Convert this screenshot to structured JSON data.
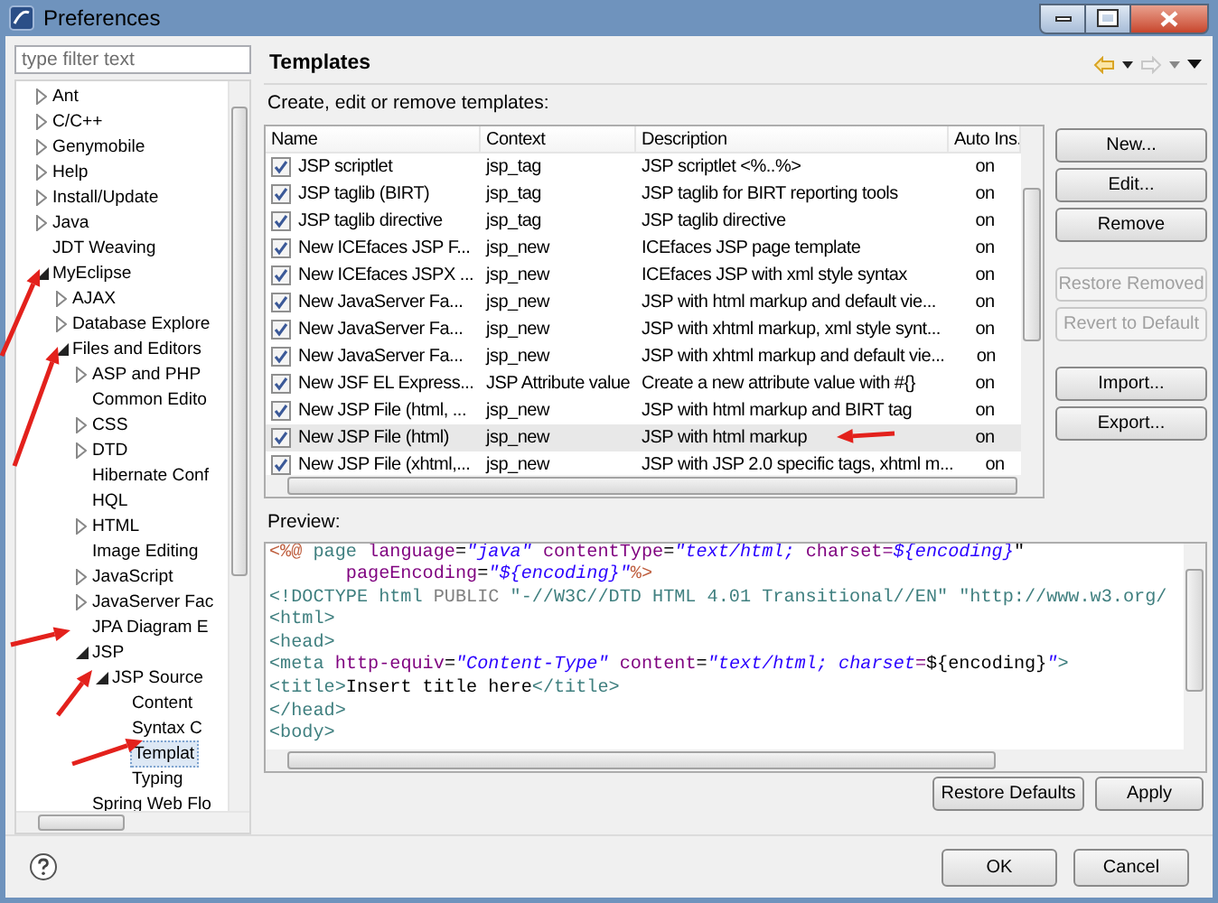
{
  "window": {
    "title": "Preferences"
  },
  "filter": {
    "placeholder": "type filter text"
  },
  "tree": [
    {
      "label": "Ant",
      "kind": "folder",
      "expanded": false,
      "selected": false
    },
    {
      "label": "C/C++",
      "kind": "folder",
      "expanded": false,
      "selected": false
    },
    {
      "label": "Genymobile",
      "kind": "folder",
      "expanded": false,
      "selected": false
    },
    {
      "label": "Help",
      "kind": "folder",
      "expanded": false,
      "selected": false
    },
    {
      "label": "Install/Update",
      "kind": "folder",
      "expanded": false,
      "selected": false
    },
    {
      "label": "Java",
      "kind": "folder",
      "expanded": false,
      "selected": false
    },
    {
      "label": "JDT Weaving",
      "kind": "leaf",
      "selected": false
    },
    {
      "label": "MyEclipse",
      "kind": "folder",
      "expanded": true,
      "selected": false,
      "children": [
        {
          "label": "AJAX",
          "kind": "folder",
          "expanded": false,
          "selected": false
        },
        {
          "label": "Database Explore",
          "kind": "folder",
          "expanded": false,
          "selected": false
        },
        {
          "label": "Files and Editors",
          "kind": "folder",
          "expanded": true,
          "selected": false,
          "children": [
            {
              "label": "ASP and PHP",
              "kind": "folder",
              "expanded": false,
              "selected": false
            },
            {
              "label": "Common Edito",
              "kind": "leaf",
              "selected": false
            },
            {
              "label": "CSS",
              "kind": "folder",
              "expanded": false,
              "selected": false
            },
            {
              "label": "DTD",
              "kind": "folder",
              "expanded": false,
              "selected": false
            },
            {
              "label": "Hibernate Conf",
              "kind": "leaf",
              "selected": false
            },
            {
              "label": "HQL",
              "kind": "leaf",
              "selected": false
            },
            {
              "label": "HTML",
              "kind": "folder",
              "expanded": false,
              "selected": false
            },
            {
              "label": "Image Editing",
              "kind": "leaf",
              "selected": false
            },
            {
              "label": "JavaScript",
              "kind": "folder",
              "expanded": false,
              "selected": false
            },
            {
              "label": "JavaServer Fac",
              "kind": "folder",
              "expanded": false,
              "selected": false
            },
            {
              "label": "JPA Diagram E",
              "kind": "leaf",
              "selected": false
            },
            {
              "label": "JSP",
              "kind": "folder",
              "expanded": true,
              "selected": false,
              "children": [
                {
                  "label": "JSP Source",
                  "kind": "folder",
                  "expanded": true,
                  "selected": false,
                  "children": [
                    {
                      "label": "Content",
                      "kind": "leaf",
                      "selected": false
                    },
                    {
                      "label": "Syntax C",
                      "kind": "leaf",
                      "selected": false
                    },
                    {
                      "label": "Templat",
                      "kind": "leaf",
                      "selected": true
                    },
                    {
                      "label": "Typing",
                      "kind": "leaf",
                      "selected": false
                    }
                  ]
                }
              ]
            },
            {
              "label": "Spring Web Flo",
              "kind": "leaf",
              "selected": false
            }
          ]
        }
      ]
    }
  ],
  "page": {
    "title": "Templates",
    "description": "Create, edit or remove templates:"
  },
  "table": {
    "columns": [
      "Name",
      "Context",
      "Description",
      "Auto Ins."
    ],
    "rows": [
      {
        "checked": true,
        "selected": false,
        "name": "JSP scriptlet",
        "context": "jsp_tag",
        "description": "JSP scriptlet <%..%>",
        "auto": "on"
      },
      {
        "checked": true,
        "selected": false,
        "name": "JSP taglib (BIRT)",
        "context": "jsp_tag",
        "description": "JSP taglib for BIRT reporting tools",
        "auto": "on"
      },
      {
        "checked": true,
        "selected": false,
        "name": "JSP taglib directive",
        "context": "jsp_tag",
        "description": "JSP taglib directive",
        "auto": "on"
      },
      {
        "checked": true,
        "selected": false,
        "name": "New ICEfaces JSP F...",
        "context": "jsp_new",
        "description": "ICEfaces JSP page template",
        "auto": "on"
      },
      {
        "checked": true,
        "selected": false,
        "name": "New ICEfaces JSPX ...",
        "context": "jsp_new",
        "description": "ICEfaces JSP with xml style syntax",
        "auto": "on"
      },
      {
        "checked": true,
        "selected": false,
        "name": "New JavaServer Fa...",
        "context": "jsp_new",
        "description": "JSP with html markup and default vie...",
        "auto": "on"
      },
      {
        "checked": true,
        "selected": false,
        "name": "New JavaServer Fa...",
        "context": "jsp_new",
        "description": "JSP with xhtml markup, xml style synt...",
        "auto": "on"
      },
      {
        "checked": true,
        "selected": false,
        "name": "New JavaServer Fa...",
        "context": "jsp_new",
        "description": "JSP with xhtml markup and default vie...",
        "auto": "on"
      },
      {
        "checked": true,
        "selected": false,
        "name": "New JSF EL Express...",
        "context": "JSP Attribute value",
        "description": "Create a new attribute value with #{}",
        "auto": "on"
      },
      {
        "checked": true,
        "selected": false,
        "name": "New JSP File (html, ...",
        "context": "jsp_new",
        "description": "JSP with html markup and BIRT tag",
        "auto": "on"
      },
      {
        "checked": true,
        "selected": true,
        "name": "New JSP File (html)",
        "context": "jsp_new",
        "description": "JSP with html markup",
        "auto": "on"
      },
      {
        "checked": true,
        "selected": false,
        "name": "New JSP File (xhtml,...",
        "context": "jsp_new",
        "description": "JSP with JSP 2.0 specific tags, xhtml m...",
        "auto": "on"
      }
    ]
  },
  "side_buttons": [
    {
      "label": "New...",
      "disabled": false
    },
    {
      "label": "Edit...",
      "disabled": false
    },
    {
      "label": "Remove",
      "disabled": false
    },
    {
      "label": "Restore Removed",
      "disabled": true
    },
    {
      "label": "Revert to Default",
      "disabled": true
    },
    {
      "label": "Import...",
      "disabled": false
    },
    {
      "label": "Export...",
      "disabled": false
    }
  ],
  "preview": {
    "label": "Preview:",
    "lines": [
      {
        "tokens": [
          {
            "kind": "directive",
            "text": "<%@"
          },
          {
            "kind": "tag",
            "text": " page"
          },
          {
            "kind": "attr",
            "text": " language"
          },
          {
            "kind": "plain",
            "text": "="
          },
          {
            "kind": "value",
            "text": "\"java\""
          },
          {
            "kind": "attr",
            "text": " contentType"
          },
          {
            "kind": "plain",
            "text": "="
          },
          {
            "kind": "value",
            "text": "\"text/html; "
          },
          {
            "kind": "attr",
            "text": "charset="
          },
          {
            "kind": "value",
            "text": "${encoding}"
          },
          {
            "kind": "plain",
            "text": "\""
          }
        ]
      },
      {
        "tokens": [
          {
            "kind": "attr",
            "text": "       pageEncoding"
          },
          {
            "kind": "plain",
            "text": "="
          },
          {
            "kind": "value",
            "text": "\"${encoding}\""
          },
          {
            "kind": "directive",
            "text": "%>"
          }
        ]
      },
      {
        "tokens": [
          {
            "kind": "tag",
            "text": "<!DOCTYPE html "
          },
          {
            "kind": "keyword",
            "text": "PUBLIC "
          },
          {
            "kind": "tag",
            "text": "\"-//W3C//DTD HTML 4.01 Transitional//EN\" \"http://www.w3.org/"
          }
        ]
      },
      {
        "tokens": [
          {
            "kind": "tag",
            "text": "<html>"
          }
        ]
      },
      {
        "tokens": [
          {
            "kind": "tag",
            "text": "<head>"
          }
        ]
      },
      {
        "tokens": [
          {
            "kind": "tag",
            "text": "<meta"
          },
          {
            "kind": "attr",
            "text": " http-equiv"
          },
          {
            "kind": "plain",
            "text": "="
          },
          {
            "kind": "value",
            "text": "\"Content-Type\""
          },
          {
            "kind": "attr",
            "text": " content"
          },
          {
            "kind": "plain",
            "text": "="
          },
          {
            "kind": "value",
            "text": "\"text/html; charset"
          },
          {
            "kind": "attr",
            "text": "="
          },
          {
            "kind": "plain",
            "text": "${encoding}"
          },
          {
            "kind": "value",
            "text": "\""
          },
          {
            "kind": "tag",
            "text": ">"
          }
        ]
      },
      {
        "tokens": [
          {
            "kind": "tag",
            "text": "<title>"
          },
          {
            "kind": "plain",
            "text": "Insert title here"
          },
          {
            "kind": "tag",
            "text": "</title>"
          }
        ]
      },
      {
        "tokens": [
          {
            "kind": "tag",
            "text": "</head>"
          }
        ]
      },
      {
        "tokens": [
          {
            "kind": "tag",
            "text": "<body>"
          }
        ]
      }
    ]
  },
  "page_buttons": [
    "Restore Defaults",
    "Apply"
  ],
  "dialog_buttons": [
    "OK",
    "Cancel"
  ]
}
